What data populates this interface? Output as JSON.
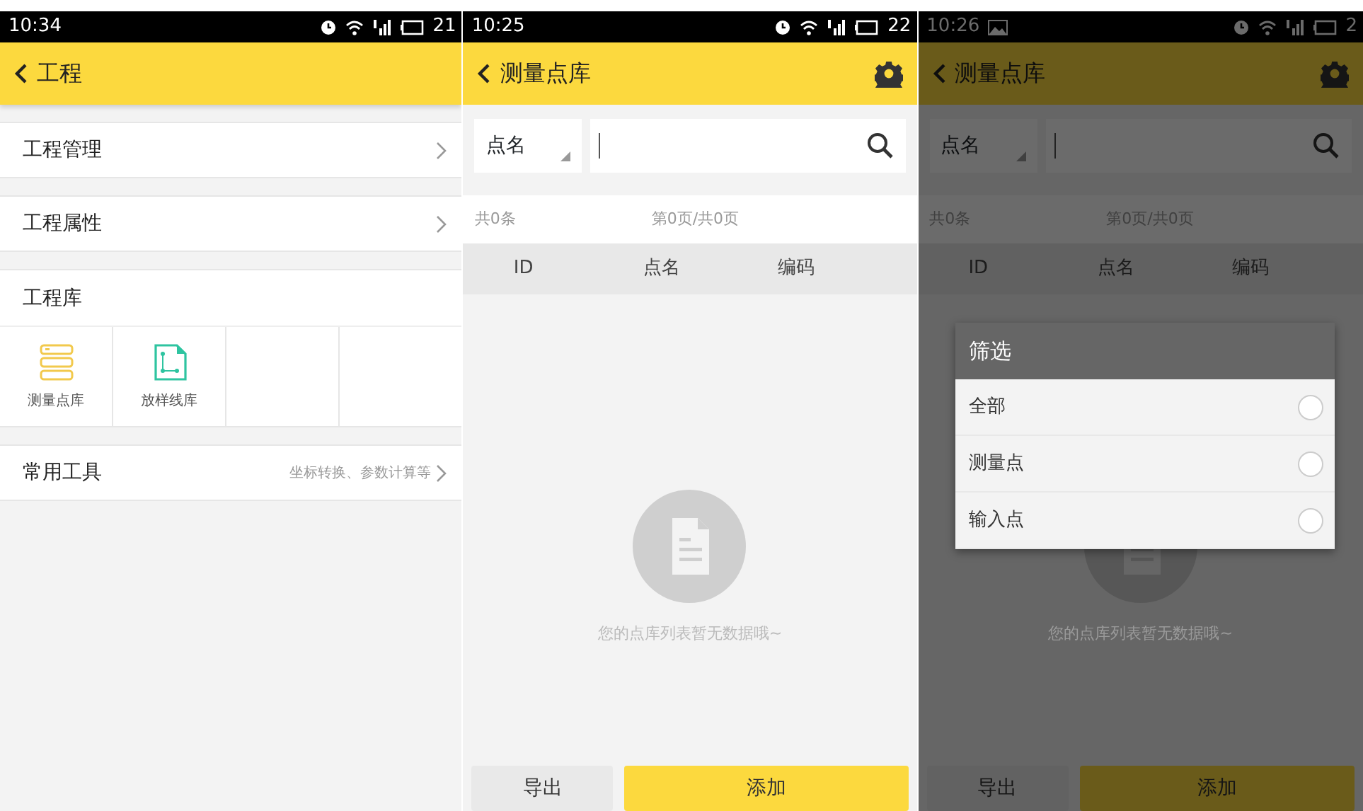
{
  "screens": [
    {
      "kind": "project",
      "status_bar": {
        "time": "10:34",
        "battery": "21",
        "photo_notice": false
      },
      "header": {
        "title": "工程",
        "settings": false
      },
      "menu": [
        {
          "label": "工程管理"
        },
        {
          "label": "工程属性"
        }
      ],
      "library": {
        "title": "工程库",
        "items": [
          {
            "label": "测量点库",
            "kind": "points"
          },
          {
            "label": "放样线库",
            "kind": "lines"
          }
        ]
      },
      "tools": {
        "label": "常用工具",
        "hint": "坐标转换、参数计算等"
      }
    },
    {
      "kind": "point_library",
      "status_bar": {
        "time": "10:25",
        "battery": "22",
        "photo_notice": false
      },
      "header": {
        "title": "测量点库",
        "settings": true
      },
      "search": {
        "field": "点名"
      },
      "counts": {
        "total": "共0条",
        "pages": "第0页/共0页"
      },
      "table": {
        "columns": [
          "ID",
          "点名",
          "编码"
        ]
      },
      "empty_text": "您的点库列表暂无数据哦~",
      "buttons": [
        {
          "label": "导出",
          "kind": "secondary"
        },
        {
          "label": "添加",
          "kind": "primary"
        }
      ]
    },
    {
      "kind": "point_library",
      "status_bar": {
        "time": "10:26",
        "battery": "2",
        "photo_notice": true
      },
      "header": {
        "title": "测量点库",
        "settings": true
      },
      "search": {
        "field": "点名"
      },
      "counts": {
        "total": "共0条",
        "pages": "第0页/共0页"
      },
      "table": {
        "columns": [
          "ID",
          "点名",
          "编码"
        ]
      },
      "empty_text": "您的点库列表暂无数据哦~",
      "buttons": [
        {
          "label": "导出",
          "kind": "secondary"
        },
        {
          "label": "添加",
          "kind": "primary"
        }
      ],
      "dialog": {
        "title": "筛选",
        "options": [
          {
            "label": "全部",
            "selected": false
          },
          {
            "label": "测量点",
            "selected": false
          },
          {
            "label": "输入点",
            "selected": false
          }
        ]
      }
    }
  ]
}
